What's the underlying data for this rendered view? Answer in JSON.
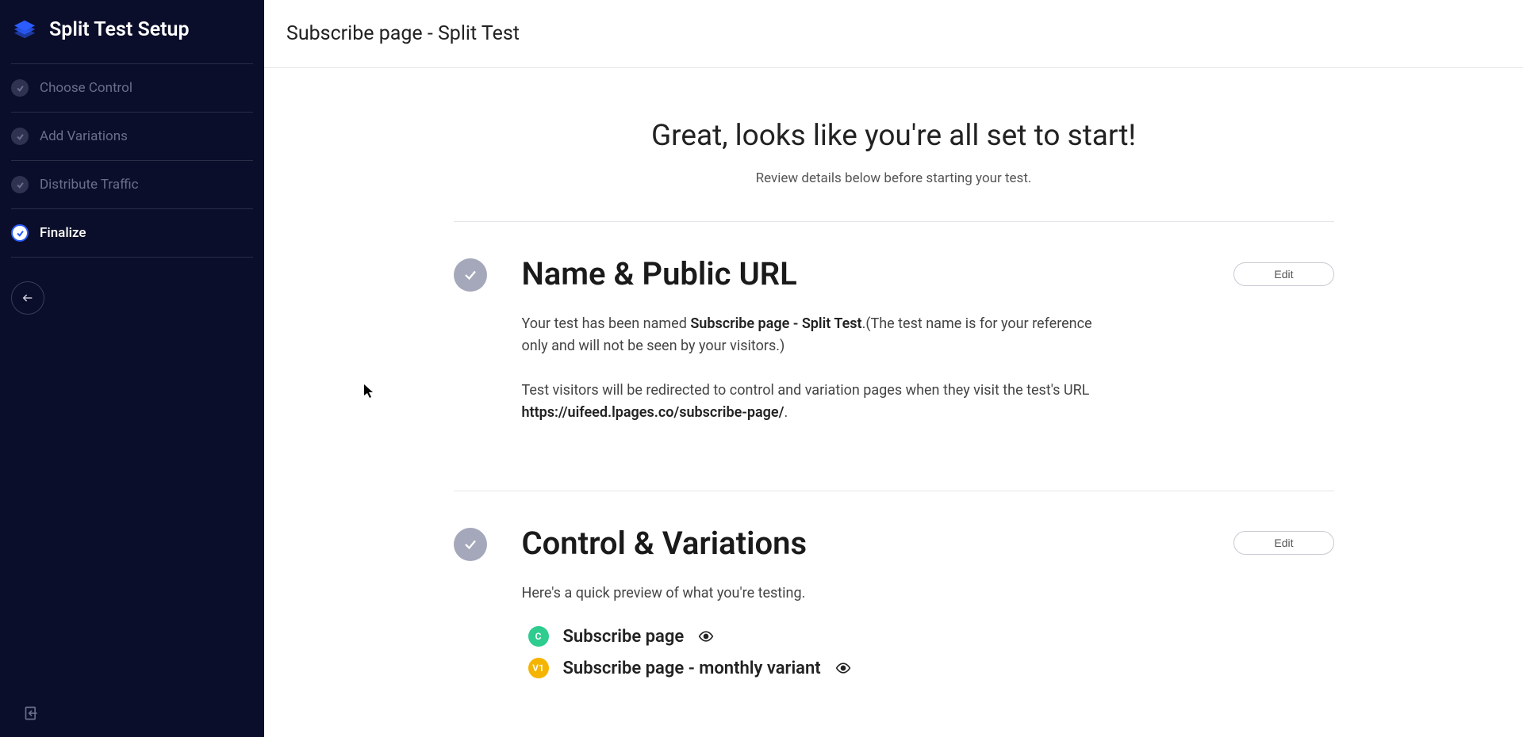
{
  "sidebar": {
    "title": "Split Test Setup",
    "steps": [
      {
        "label": "Choose Control",
        "active": false
      },
      {
        "label": "Add Variations",
        "active": false
      },
      {
        "label": "Distribute Traffic",
        "active": false
      },
      {
        "label": "Finalize",
        "active": true
      }
    ]
  },
  "header": {
    "page_title": "Subscribe page - Split Test"
  },
  "hero": {
    "title": "Great, looks like you're all set to start!",
    "subtitle": "Review details below before starting your test."
  },
  "name_section": {
    "title": "Name & Public URL",
    "edit_label": "Edit",
    "para1_prefix": "Your test has been named ",
    "para1_name": "Subscribe page - Split Test",
    "para1_suffix": ".(The test name is for your reference only and will not be seen by your visitors.)",
    "para2_prefix": "Test visitors will be redirected to control and variation pages when they visit the test's URL ",
    "para2_url": "https://uifeed.lpages.co/subscribe-page/",
    "para2_suffix": "."
  },
  "variations_section": {
    "title": "Control & Variations",
    "edit_label": "Edit",
    "intro": "Here's a quick preview of what you're testing.",
    "items": [
      {
        "badge": "C",
        "badge_class": "badge-c",
        "name": "Subscribe page"
      },
      {
        "badge": "V1",
        "badge_class": "badge-v",
        "name": "Subscribe page - monthly variant"
      }
    ]
  }
}
